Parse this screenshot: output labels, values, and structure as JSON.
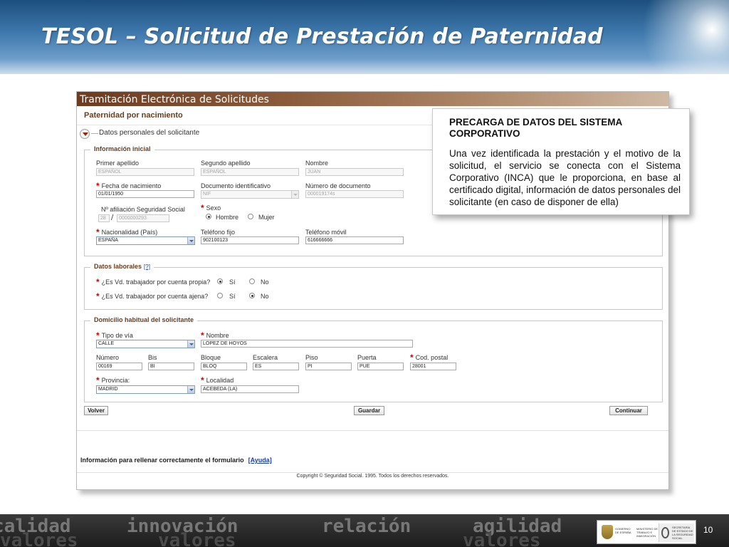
{
  "slide": {
    "title": "TESOL – Solicitud de Prestación de Paternidad",
    "page_number": "10"
  },
  "app": {
    "window_title": "Tramitación Electrónica de Solicitudes",
    "form_heading": "Paternidad por nacimiento",
    "section_title": "Datos personales del solicitante"
  },
  "info_inicial": {
    "legend": "Información inicial",
    "primer_apellido": {
      "label": "Primer apellido",
      "value": "ESPAÑOL"
    },
    "segundo_apellido": {
      "label": "Segundo apellido",
      "value": "ESPAÑOL"
    },
    "nombre": {
      "label": "Nombre",
      "value": "JUAN"
    },
    "fecha_nacimiento": {
      "label": "Fecha de nacimiento",
      "value": "01/01/1950"
    },
    "documento": {
      "label": "Documento identificativo",
      "value": "NIF"
    },
    "numero_documento": {
      "label": "Número de documento",
      "value": "000019174s"
    },
    "afiliacion": {
      "label": "Nº afiliación Seguridad Social",
      "prefix": "28",
      "separator": "/",
      "value": "0000000293"
    },
    "sexo": {
      "label": "Sexo",
      "option_hombre": "Hombre",
      "option_mujer": "Mujer",
      "selected": "Hombre"
    },
    "nacionalidad": {
      "label": "Nacionalidad (País)",
      "value": "ESPAÑA"
    },
    "telefono_fijo": {
      "label": "Teléfono fijo",
      "value": "902100123"
    },
    "telefono_movil": {
      "label": "Teléfono móvil",
      "value": "616666666"
    }
  },
  "datos_laborales": {
    "legend": "Datos laborales",
    "help_link": "[?]",
    "cuenta_propia": {
      "label": "¿Es Vd. trabajador por cuenta propia?",
      "option_si": "Sí",
      "option_no": "No",
      "selected": "Sí"
    },
    "cuenta_ajena": {
      "label": "¿Es Vd. trabajador por cuenta ajena?",
      "option_si": "Sí",
      "option_no": "No",
      "selected": "No"
    }
  },
  "domicilio": {
    "legend": "Domicilio habitual del solicitante",
    "tipo_via": {
      "label": "Tipo de vía",
      "value": "CALLE"
    },
    "nombre": {
      "label": "Nombre",
      "value": "LOPEZ DE HOYOS"
    },
    "numero": {
      "label": "Número",
      "value": "00169"
    },
    "bis": {
      "label": "Bis",
      "value": "BI"
    },
    "bloque": {
      "label": "Bloque",
      "value": "BLOQ"
    },
    "escalera": {
      "label": "Escalera",
      "value": "ES"
    },
    "piso": {
      "label": "Piso",
      "value": "PI"
    },
    "puerta": {
      "label": "Puerta",
      "value": "PUE"
    },
    "cod_postal": {
      "label": "Cod. postal",
      "value": "28001"
    },
    "provincia": {
      "label": "Provincia:",
      "value": "MADRID"
    },
    "localidad": {
      "label": "Localidad",
      "value": "ACEBEDA (LA)"
    }
  },
  "buttons": {
    "volver": "Volver",
    "guardar": "Guardar",
    "continuar": "Continuar"
  },
  "info": {
    "text": "Información para rellenar correctamente el formulario",
    "link": "[Ayuda]"
  },
  "copyright": "Copyright © Seguridad Social. 1995. Todos los derechos reservados.",
  "callout": {
    "title": "PRECARGA DE DATOS DEL SISTEMA CORPORATIVO",
    "body": "Una vez identificada la prestación y el motivo de la solicitud, el servicio se conecta con el Sistema Corporativo (INCA) que le proporciona, en base al certificado digital, información de datos personales del solicitante (en caso de disponer de ella)"
  },
  "footer": {
    "words": [
      "calidad",
      "innovación",
      "relación",
      "agilidad"
    ],
    "faint_words": [
      "valores",
      "valores",
      "valores"
    ],
    "logo_left": "GOBIERNO DE ESPAÑA",
    "logo_ministry": "MINISTERIO DE TRABAJO E INMIGRACIÓN",
    "logo_right": "SECRETARÍA DE ESTADO DE LA SEGURIDAD SOCIAL"
  },
  "colors": {
    "header_blue": "#1c4f7e",
    "window_bar_brown": "#6e3b1f",
    "legend_brown": "#6a3c1c",
    "required_red": "#d40000",
    "link_blue": "#1a3fa8"
  }
}
